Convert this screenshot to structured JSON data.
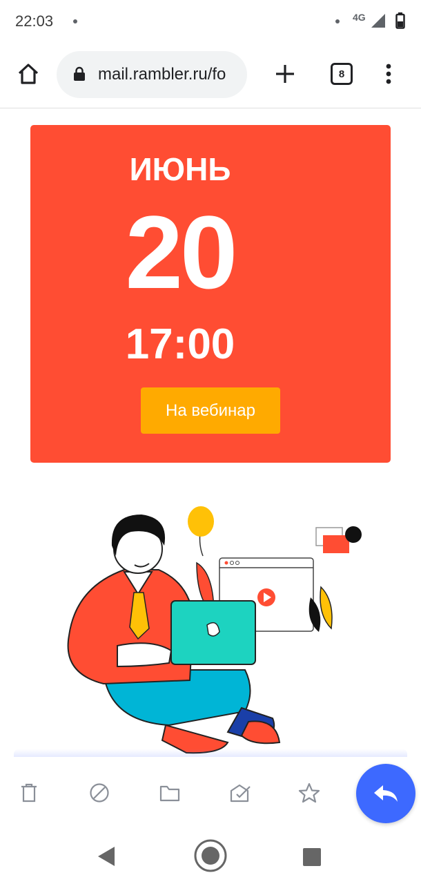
{
  "status_bar": {
    "time": "22:03",
    "network": "4G"
  },
  "browser": {
    "url": "mail.rambler.ru/fo",
    "tab_count": "8"
  },
  "event": {
    "month": "ИЮНЬ",
    "day": "20",
    "time": "17:00",
    "cta_label": "На вебинар",
    "card_color": "#ff4d33",
    "cta_color": "#ffaa00"
  },
  "actions": {
    "items": [
      "trash-icon",
      "block-icon",
      "folder-icon",
      "mark-read-icon",
      "star-icon"
    ],
    "fab": "reply-icon",
    "fab_color": "#3d69ff"
  },
  "nav": {
    "items": [
      "back",
      "home",
      "recent-apps"
    ]
  }
}
